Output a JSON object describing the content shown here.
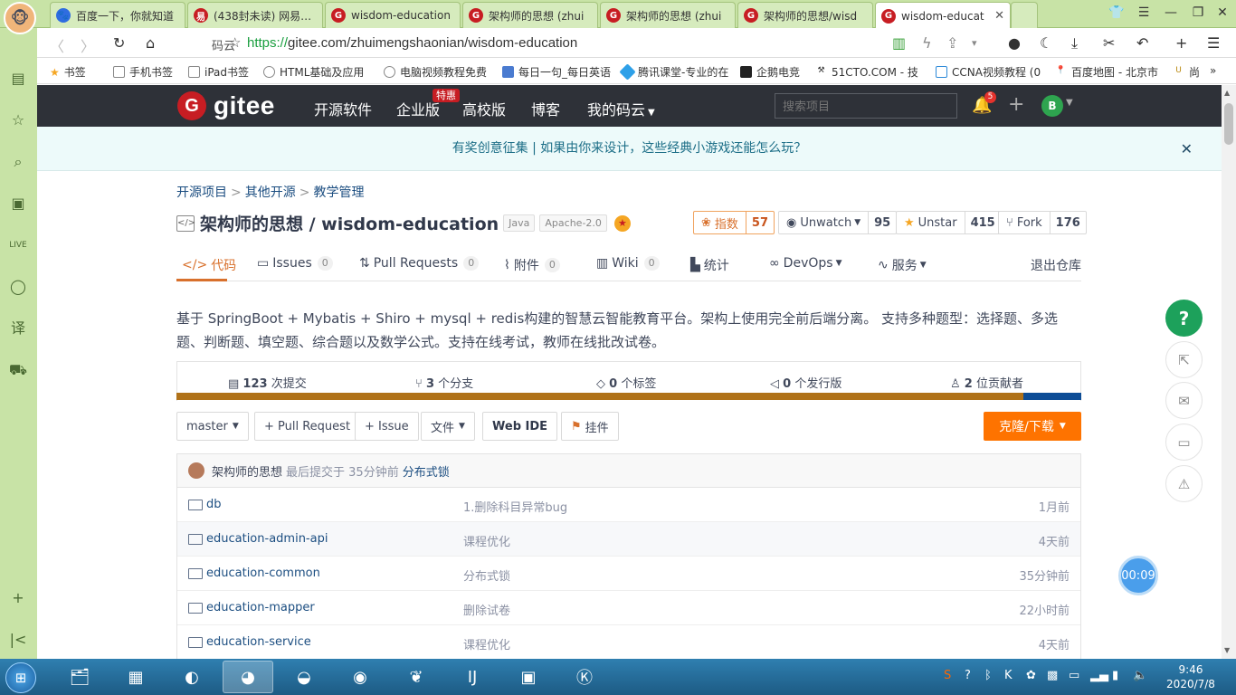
{
  "browser": {
    "tabs": [
      {
        "label": "百度一下，你就知道",
        "icon": "baidu-paw-icon"
      },
      {
        "label": "(438封未读) 网易邮箱",
        "icon": "netease-mail-icon"
      },
      {
        "label": "wisdom-education",
        "icon": "gitee-icon"
      },
      {
        "label": "架构师的思想 (zhui",
        "icon": "gitee-icon"
      },
      {
        "label": "架构师的思想 (zhui",
        "icon": "gitee-icon"
      },
      {
        "label": "架构师的思想/wisd",
        "icon": "gitee-icon"
      },
      {
        "label": "wisdom-educat",
        "icon": "gitee-icon",
        "active": true
      }
    ],
    "tab_close": "✕",
    "domain_tag": "码云",
    "url_scheme": "https://",
    "url_rest": "gitee.com/zhuimengshaonian/wisdom-education",
    "bookmarks": [
      "书签",
      "手机书签",
      "iPad书签",
      "HTML基础及应用",
      "电脑视频教程免费",
      "每日一句_每日英语",
      "腾讯课堂-专业的在",
      "企鹅电竞",
      "51CTO.COM - 技",
      "CCNA视频教程 (0",
      "百度地图 - 北京市",
      "尚"
    ]
  },
  "gitee": {
    "logo_text": "gitee",
    "logo_mark": "G",
    "nav": [
      "开源软件",
      "企业版",
      "高校版",
      "博客",
      "我的码云"
    ],
    "hot_badge": "特惠",
    "search_placeholder": "搜索项目",
    "notif_count": "5",
    "user_initial": "B",
    "notice": "有奖创意征集 | 如果由你来设计，这些经典小游戏还能怎么玩？",
    "notice_close": "✕"
  },
  "repo": {
    "breadcrumb": [
      "开源项目",
      "其他开源",
      "教学管理"
    ],
    "breadcrumb_sep": ">",
    "title": "架构师的思想 / wisdom-education",
    "tags": [
      "Java",
      "Apache-2.0"
    ],
    "stats": [
      {
        "label": "指数",
        "value": "57"
      },
      {
        "label": "Unwatch",
        "value": "95"
      },
      {
        "label": "Unstar",
        "value": "415"
      },
      {
        "label": "Fork",
        "value": "176"
      }
    ],
    "tabs": [
      {
        "label": "代码"
      },
      {
        "label": "Issues",
        "count": "0"
      },
      {
        "label": "Pull Requests",
        "count": "0"
      },
      {
        "label": "附件",
        "count": "0"
      },
      {
        "label": "Wiki",
        "count": "0"
      },
      {
        "label": "统计"
      },
      {
        "label": "DevOps"
      },
      {
        "label": "服务"
      },
      {
        "label": "退出仓库"
      }
    ],
    "description": "基于 SpringBoot + Mybatis + Shiro + mysql + redis构建的智慧云智能教育平台。架构上使用完全前后端分离。 支持多种题型：选择题、多选题、判断题、填空题、综合题以及数学公式。支持在线考试，教师在线批改试卷。",
    "summary": [
      {
        "num": "123",
        "label": "次提交"
      },
      {
        "num": "3",
        "label": "个分支"
      },
      {
        "num": "0",
        "label": "个标签"
      },
      {
        "num": "0",
        "label": "个发行版"
      },
      {
        "num": "2",
        "label": "位贡献者"
      }
    ],
    "languages": [
      {
        "color": "#b07219",
        "fraction": 0.936
      },
      {
        "color": "#0e4d96",
        "fraction": 0.064
      }
    ],
    "toolbar": {
      "branch": "master",
      "pull_request": "+ Pull Request",
      "issue": "+ Issue",
      "files": "文件",
      "web_ide": "Web IDE",
      "widget": "挂件",
      "clone": "克隆/下载"
    },
    "last_commit": {
      "author": "架构师的思想",
      "meta": "最后提交于 35分钟前",
      "message": "分布式锁"
    },
    "files": [
      {
        "name": "db",
        "message": "1.删除科目异常bug",
        "time": "1月前"
      },
      {
        "name": "education-admin-api",
        "message": "课程优化",
        "time": "4天前"
      },
      {
        "name": "education-common",
        "message": "分布式锁",
        "time": "35分钟前"
      },
      {
        "name": "education-mapper",
        "message": "删除试卷",
        "time": "22小时前"
      },
      {
        "name": "education-service",
        "message": "课程优化",
        "time": "4天前"
      }
    ]
  },
  "floating": {
    "help": "?",
    "timer": "00:09"
  },
  "taskbar": {
    "time": "9:46",
    "date": "2020/7/8"
  }
}
